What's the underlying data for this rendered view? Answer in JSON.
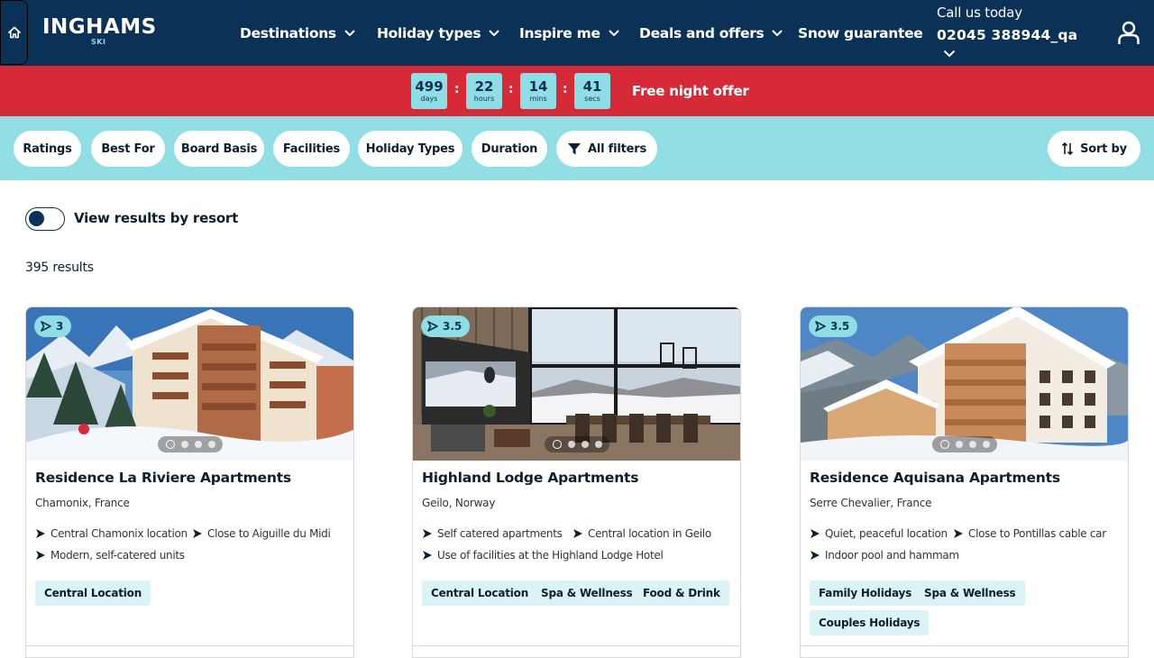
{
  "header": {
    "logo_main": "INGHAMS",
    "logo_sub": "SKI",
    "nav": [
      "Destinations",
      "Holiday types",
      "Inspire me",
      "Deals and offers",
      "Snow guarantee"
    ],
    "call_label": "Call us today",
    "call_number": "02045 388944_qa"
  },
  "promo": {
    "days": "499",
    "days_label": "days",
    "hours": "22",
    "hours_label": "hours",
    "mins": "14",
    "mins_label": "mins",
    "secs": "41",
    "secs_label": "secs",
    "text": "Free night offer"
  },
  "filters": {
    "ratings": "Ratings",
    "best_for": "Best For",
    "board_basis": "Board Basis",
    "facilities": "Facilities",
    "holiday_types": "Holiday Types",
    "duration": "Duration",
    "all_filters": "All filters",
    "sort_by": "Sort by"
  },
  "toggle_label": "View results by resort",
  "results_count": "395 results",
  "cards": [
    {
      "rating": "3",
      "title": "Residence La Riviere Apartments",
      "location": "Chamonix, France",
      "features": [
        "Central Chamonix location",
        "Close to Aiguille du Midi",
        "Modern, self-catered units"
      ],
      "tags": [
        "Central Location"
      ]
    },
    {
      "rating": "3.5",
      "title": "Highland Lodge Apartments",
      "location": "Geilo, Norway",
      "features": [
        "Self catered apartments",
        "Central location in Geilo",
        "Use of facilities at the Highland Lodge Hotel"
      ],
      "tags": [
        "Central Location",
        "Spa & Wellness",
        "Food & Drink"
      ]
    },
    {
      "rating": "3.5",
      "title": "Residence Aquisana Apartments",
      "location": "Serre Chevalier, France",
      "features": [
        "Quiet, peaceful location",
        "Close to Pontillas cable car",
        "Indoor pool and hammam"
      ],
      "tags": [
        "Family Holidays",
        "Spa & Wellness",
        "Couples Holidays"
      ]
    }
  ],
  "colors": {
    "navy": "#0b3256",
    "red": "#d72a38",
    "aqua": "#92dee5",
    "tag_bg": "#dcf3f6"
  }
}
